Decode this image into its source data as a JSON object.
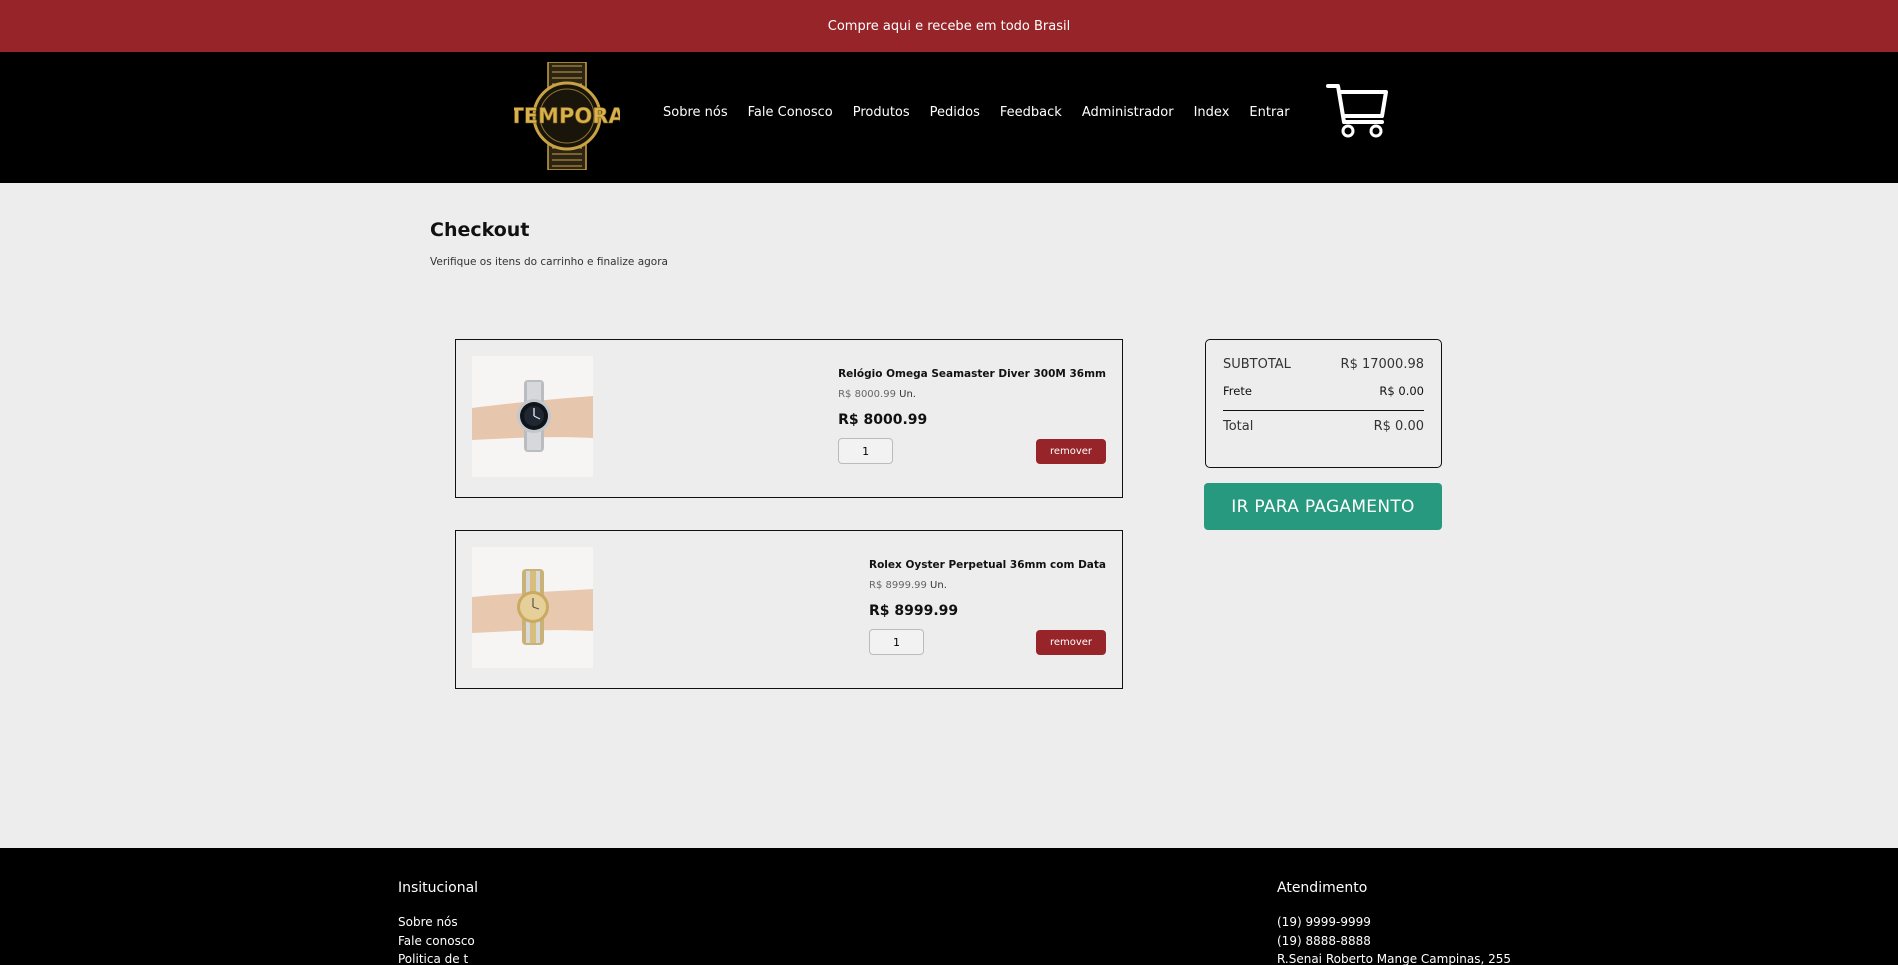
{
  "promo": {
    "text": "Compre aqui e recebe em todo Brasil"
  },
  "header": {
    "logo_text": "TEMPORA",
    "nav": [
      "Sobre nós",
      "Fale Conosco",
      "Produtos",
      "Pedidos",
      "Feedback",
      "Administrador",
      "Index",
      "Entrar"
    ]
  },
  "page": {
    "title": "Checkout",
    "subtitle": "Verifique os itens do carrinho e finalize agora"
  },
  "cart": {
    "items": [
      {
        "name": "Relógio Omega Seamaster Diver 300M 36mm",
        "unit_price": "R$ 8000.99",
        "unit_suffix": "Un.",
        "price": "R$ 8000.99",
        "qty": "1",
        "remove_label": "remover"
      },
      {
        "name": "Rolex Oyster Perpetual 36mm com Data",
        "unit_price": "R$ 8999.99",
        "unit_suffix": "Un.",
        "price": "R$ 8999.99",
        "qty": "1",
        "remove_label": "remover"
      }
    ]
  },
  "summary": {
    "subtotal_label": "SUBTOTAL",
    "subtotal_value": "R$ 17000.98",
    "frete_label": "Frete",
    "frete_value": "R$ 0.00",
    "total_label": "Total",
    "total_value": "R$ 0.00",
    "pay_button": "IR PARA PAGAMENTO"
  },
  "footer": {
    "col1": {
      "title": "Insitucional",
      "lines": [
        "Sobre nós",
        "Fale conosco",
        "Politica de t"
      ]
    },
    "col2": {
      "title": "Atendimento",
      "lines": [
        "(19) 9999-9999",
        "(19) 8888-8888",
        "R.Senai Roberto Mange Campinas, 255"
      ]
    }
  },
  "colors": {
    "brand_red": "#962428",
    "pay_green": "#26997f",
    "gold": "#c9a244"
  },
  "icons": {
    "cart": "cart-icon",
    "logo": "watch-logo-icon"
  }
}
